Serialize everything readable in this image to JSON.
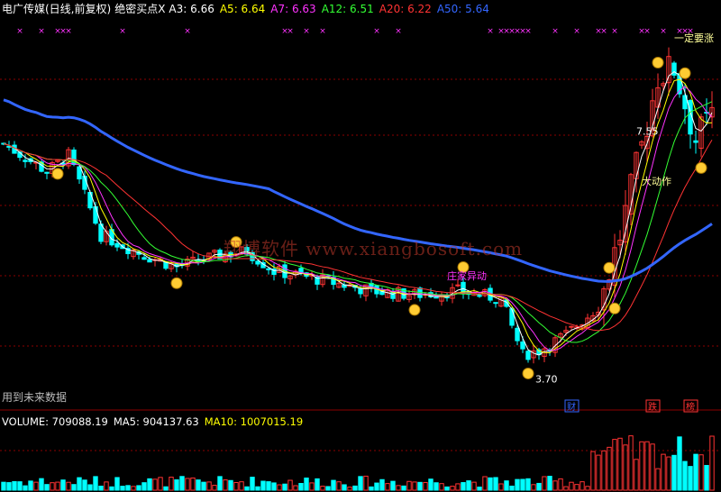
{
  "header": {
    "title": "电广传媒(日线,前复权)",
    "indicator": "绝密买点X",
    "ma_items": [
      {
        "label": "A3: 6.66",
        "color": "#ffffff"
      },
      {
        "label": "A5: 6.64",
        "color": "#ffff00"
      },
      {
        "label": "A7: 6.63",
        "color": "#ff33ff"
      },
      {
        "label": "A12: 6.51",
        "color": "#33ff33"
      },
      {
        "label": "A20: 6.22",
        "color": "#ff3333"
      },
      {
        "label": "A50: 5.64",
        "color": "#3366ff"
      }
    ]
  },
  "volume_header": {
    "items": [
      {
        "label": "VOLUME: 709088.19",
        "color": "#ffffff"
      },
      {
        "label": "MA5: 904137.63",
        "color": "#ffffff"
      },
      {
        "label": "MA10: 1007015.19",
        "color": "#ffff00"
      }
    ]
  },
  "note": "用到未来数据",
  "watermark": "翔博软件 www.xiangbosoft.com",
  "colors": {
    "background": "#000000",
    "up": "#ff3333",
    "down": "#00ffff",
    "ma50": "#3366ff",
    "grid": "#8b0000",
    "marker": "#ff33ff",
    "annotation_yellow": "#ffff99",
    "annotation_magenta": "#ff33ff",
    "badge_blue": "#3366ff",
    "badge_red": "#ff3333"
  },
  "chart_data": {
    "type": "candlestick",
    "annotations": [
      {
        "text": "7.55",
        "kind": "high-label",
        "bar": 118
      },
      {
        "text": "一定要涨",
        "kind": "yellow-note",
        "bar": 124
      },
      {
        "text": "大动作",
        "kind": "yellow-note",
        "bar": 118
      },
      {
        "text": "庄家异动",
        "kind": "magenta-note",
        "bar": 82
      },
      {
        "text": "3.70",
        "kind": "low-label",
        "bar": 97
      }
    ],
    "event_badges": [
      {
        "text": "财",
        "bar": 105,
        "color": "#3366ff"
      },
      {
        "text": "跌",
        "bar": 120,
        "color": "#ff3333"
      },
      {
        "text": "榜",
        "bar": 127,
        "color": "#ff3333"
      }
    ],
    "money_bag_bars": [
      10,
      32,
      76,
      97,
      113,
      129
    ],
    "smiley_bars": [
      43,
      85,
      112,
      121,
      126
    ],
    "marker_bars": [
      3,
      7,
      10,
      11,
      12,
      22,
      34,
      52,
      53,
      56,
      59,
      69,
      73,
      90,
      92,
      93,
      94,
      95,
      96,
      97,
      102,
      106,
      110,
      111,
      113,
      118,
      119,
      122,
      125,
      126,
      127
    ]
  }
}
